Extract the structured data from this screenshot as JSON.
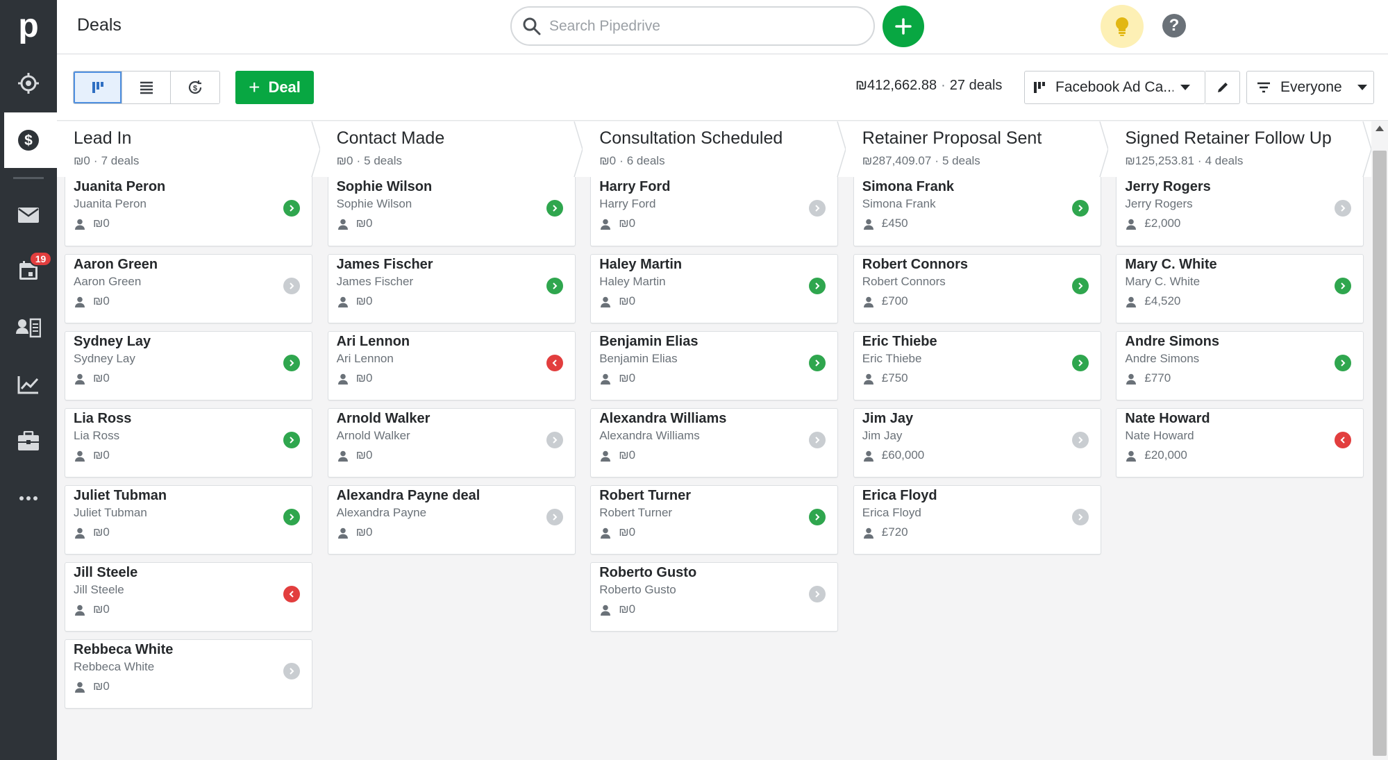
{
  "app": {
    "logo": "p",
    "page_title": "Deals"
  },
  "sidebar": {
    "items": [
      {
        "name": "focus-icon"
      },
      {
        "name": "deals-dollar-icon",
        "active": true
      },
      {
        "name": "mail-icon"
      },
      {
        "name": "calendar-icon",
        "badge": "19"
      },
      {
        "name": "contacts-icon"
      },
      {
        "name": "insights-chart-icon"
      },
      {
        "name": "products-box-icon"
      },
      {
        "name": "more-icon"
      }
    ]
  },
  "search": {
    "placeholder": "Search Pipedrive"
  },
  "toolbar": {
    "deal_label": "Deal",
    "total_value": "₪412,662.88",
    "deal_count": "27 deals",
    "pipeline": "Facebook Ad Ca...",
    "owner_filter": "Everyone"
  },
  "stages": [
    {
      "name": "Lead In",
      "value": "₪0",
      "count": "7 deals",
      "deals": [
        {
          "title": "Juanita Peron",
          "person": "Juanita Peron",
          "value": "₪0",
          "status": "green"
        },
        {
          "title": "Aaron Green",
          "person": "Aaron Green",
          "value": "₪0",
          "status": "gray"
        },
        {
          "title": "Sydney Lay",
          "person": "Sydney Lay",
          "value": "₪0",
          "status": "green"
        },
        {
          "title": "Lia Ross",
          "person": "Lia Ross",
          "value": "₪0",
          "status": "green"
        },
        {
          "title": "Juliet Tubman",
          "person": "Juliet Tubman",
          "value": "₪0",
          "status": "green"
        },
        {
          "title": "Jill Steele",
          "person": "Jill Steele",
          "value": "₪0",
          "status": "red"
        },
        {
          "title": "Rebbeca White",
          "person": "Rebbeca White",
          "value": "₪0",
          "status": "gray"
        }
      ]
    },
    {
      "name": "Contact Made",
      "value": "₪0",
      "count": "5 deals",
      "deals": [
        {
          "title": "Sophie Wilson",
          "person": "Sophie Wilson",
          "value": "₪0",
          "status": "green"
        },
        {
          "title": "James Fischer",
          "person": "James Fischer",
          "value": "₪0",
          "status": "green"
        },
        {
          "title": "Ari Lennon",
          "person": "Ari Lennon",
          "value": "₪0",
          "status": "red"
        },
        {
          "title": "Arnold Walker",
          "person": "Arnold Walker",
          "value": "₪0",
          "status": "gray"
        },
        {
          "title": "Alexandra Payne deal",
          "person": "Alexandra Payne",
          "value": "₪0",
          "status": "gray"
        }
      ]
    },
    {
      "name": "Consultation Scheduled",
      "value": "₪0",
      "count": "6 deals",
      "deals": [
        {
          "title": "Harry Ford",
          "person": "Harry Ford",
          "value": "₪0",
          "status": "gray"
        },
        {
          "title": "Haley Martin",
          "person": "Haley Martin",
          "value": "₪0",
          "status": "green"
        },
        {
          "title": "Benjamin Elias",
          "person": "Benjamin Elias",
          "value": "₪0",
          "status": "green"
        },
        {
          "title": "Alexandra Williams",
          "person": "Alexandra Williams",
          "value": "₪0",
          "status": "gray"
        },
        {
          "title": "Robert Turner",
          "person": "Robert Turner",
          "value": "₪0",
          "status": "green"
        },
        {
          "title": "Roberto Gusto",
          "person": "Roberto Gusto",
          "value": "₪0",
          "status": "gray"
        }
      ]
    },
    {
      "name": "Retainer Proposal Sent",
      "value": "₪287,409.07",
      "count": "5 deals",
      "deals": [
        {
          "title": "Simona Frank",
          "person": "Simona Frank",
          "value": "£450",
          "status": "green"
        },
        {
          "title": "Robert Connors",
          "person": "Robert Connors",
          "value": "£700",
          "status": "green"
        },
        {
          "title": "Eric Thiebe",
          "person": "Eric Thiebe",
          "value": "£750",
          "status": "green"
        },
        {
          "title": "Jim Jay",
          "person": "Jim Jay",
          "value": "£60,000",
          "status": "gray"
        },
        {
          "title": "Erica Floyd",
          "person": "Erica Floyd",
          "value": "£720",
          "status": "gray"
        }
      ]
    },
    {
      "name": "Signed Retainer Follow Up",
      "value": "₪125,253.81",
      "count": "4 deals",
      "deals": [
        {
          "title": "Jerry Rogers",
          "person": "Jerry Rogers",
          "value": "£2,000",
          "status": "gray"
        },
        {
          "title": "Mary C. White",
          "person": "Mary C. White",
          "value": "£4,520",
          "status": "green"
        },
        {
          "title": "Andre Simons",
          "person": "Andre Simons",
          "value": "£770",
          "status": "green"
        },
        {
          "title": "Nate Howard",
          "person": "Nate Howard",
          "value": "£20,000",
          "status": "red"
        }
      ]
    }
  ],
  "colors": {
    "brand_green": "#08a742",
    "sidebar_bg": "#2e3338",
    "status_green": "#2fa64e",
    "status_red": "#e23e3e",
    "status_gray": "#c9cdd1"
  }
}
